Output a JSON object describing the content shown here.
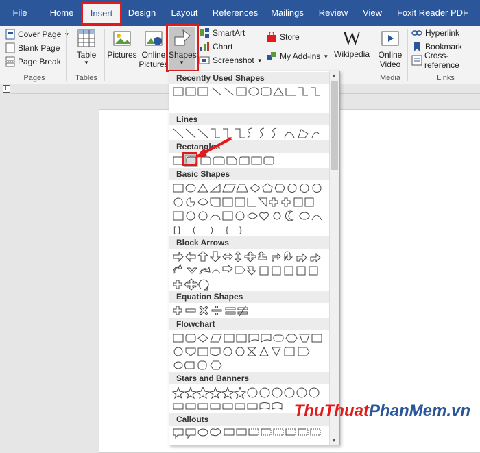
{
  "tabs": [
    "File",
    "Home",
    "Insert",
    "Design",
    "Layout",
    "References",
    "Mailings",
    "Review",
    "View",
    "Foxit Reader PDF"
  ],
  "pages_group": {
    "cover_page": "Cover Page",
    "blank_page": "Blank Page",
    "page_break": "Page Break",
    "label": "Pages"
  },
  "tables_group": {
    "table": "Table",
    "label": "Tables"
  },
  "illustrations_group": {
    "pictures": "Pictures",
    "online_pictures": "Online Pictures",
    "shapes": "Shapes",
    "smartart": "SmartArt",
    "chart": "Chart",
    "screenshot": "Screenshot"
  },
  "addins_group": {
    "store": "Store",
    "my_addins": "My Add-ins",
    "wikipedia": "Wikipedia"
  },
  "media_group": {
    "online_video": "Online Video",
    "label": "Media"
  },
  "links_group": {
    "hyperlink": "Hyperlink",
    "bookmark": "Bookmark",
    "cross_reference": "Cross-reference",
    "label": "Links"
  },
  "shapes_panel": {
    "sections": [
      "Recently Used Shapes",
      "Lines",
      "Rectangles",
      "Basic Shapes",
      "Block Arrows",
      "Equation Shapes",
      "Flowchart",
      "Stars and Banners",
      "Callouts"
    ]
  },
  "watermark": {
    "part1": "ThuThuat",
    "part2": "PhanMem",
    "part3": ".vn"
  },
  "colors": {
    "ribbon_blue": "#2b579a",
    "highlight_red": "#e01b1b"
  }
}
